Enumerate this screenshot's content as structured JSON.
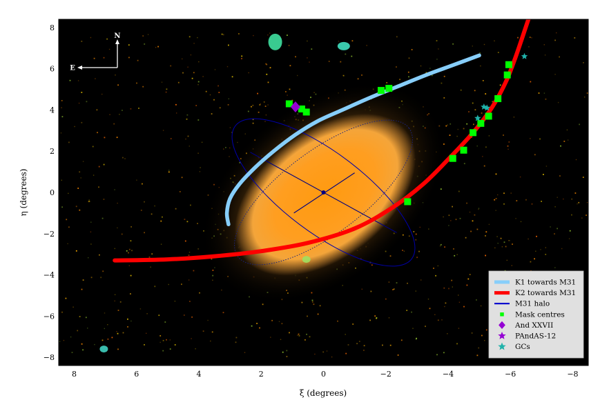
{
  "chart_data": {
    "type": "scatter",
    "title": "",
    "xlabel": "ξ (degrees)",
    "ylabel": "η (degrees)",
    "xlim": [
      8.5,
      -8.5
    ],
    "ylim": [
      -8.4,
      8.4
    ],
    "x_ticks": [
      8,
      6,
      4,
      2,
      0,
      -2,
      -4,
      -6,
      -8
    ],
    "y_ticks": [
      8,
      6,
      4,
      2,
      0,
      -2,
      -4,
      -6,
      -8
    ],
    "grid": false,
    "legend_position": "bottom-right",
    "background": "map of M31 stellar density (black background, orange disc)",
    "compass": {
      "north": "N",
      "east": "E"
    },
    "series": [
      {
        "name": "K1 towards M31",
        "kind": "line",
        "color": "#87cefa",
        "x": [
          3.05,
          3.1,
          3.0,
          2.7,
          2.2,
          1.6,
          0.9,
          0.2,
          -0.6,
          -1.5,
          -2.4,
          -3.3,
          -4.2,
          -5.0
        ],
        "y": [
          -1.55,
          -1.0,
          -0.3,
          0.4,
          1.2,
          2.0,
          2.8,
          3.45,
          4.0,
          4.6,
          5.15,
          5.7,
          6.2,
          6.65
        ]
      },
      {
        "name": "K2 towards M31",
        "kind": "line",
        "color": "#ff0000",
        "x": [
          6.7,
          5.0,
          3.5,
          2.0,
          0.5,
          -1.0,
          -2.2,
          -3.2,
          -4.0,
          -4.8,
          -5.4,
          -5.85,
          -6.15,
          -6.4,
          -6.6
        ],
        "y": [
          -3.3,
          -3.25,
          -3.1,
          -2.85,
          -2.45,
          -1.75,
          -0.75,
          0.4,
          1.6,
          2.9,
          4.1,
          5.35,
          6.5,
          7.6,
          8.5
        ]
      },
      {
        "name": "M31 halo",
        "kind": "line",
        "color": "#0000cd",
        "x": [],
        "y": []
      },
      {
        "name": "Mask centres",
        "kind": "scatter",
        "marker": "square",
        "color": "#00ff00",
        "x": [
          0.55,
          0.7,
          1.1,
          -1.85,
          -2.1,
          -2.7,
          -4.15,
          -4.5,
          -4.8,
          -5.05,
          -5.3,
          -5.6,
          -5.9,
          -5.95
        ],
        "y": [
          3.9,
          4.05,
          4.3,
          4.95,
          5.05,
          -0.45,
          1.65,
          2.05,
          2.9,
          3.35,
          3.7,
          4.55,
          5.7,
          6.2
        ]
      },
      {
        "name": "And XXVII",
        "kind": "scatter",
        "marker": "diamond",
        "color": "#9400d3",
        "x": [
          0.9
        ],
        "y": [
          4.15
        ]
      },
      {
        "name": "PAndAS-12",
        "kind": "scatter",
        "marker": "star",
        "color": "#9400d3",
        "x": [],
        "y": []
      },
      {
        "name": "GCs",
        "kind": "scatter",
        "marker": "star",
        "color": "#20b2aa",
        "x": [
          -5.15,
          -4.95,
          -5.25,
          -6.45
        ],
        "y": [
          4.15,
          3.6,
          4.1,
          6.6
        ]
      }
    ]
  }
}
